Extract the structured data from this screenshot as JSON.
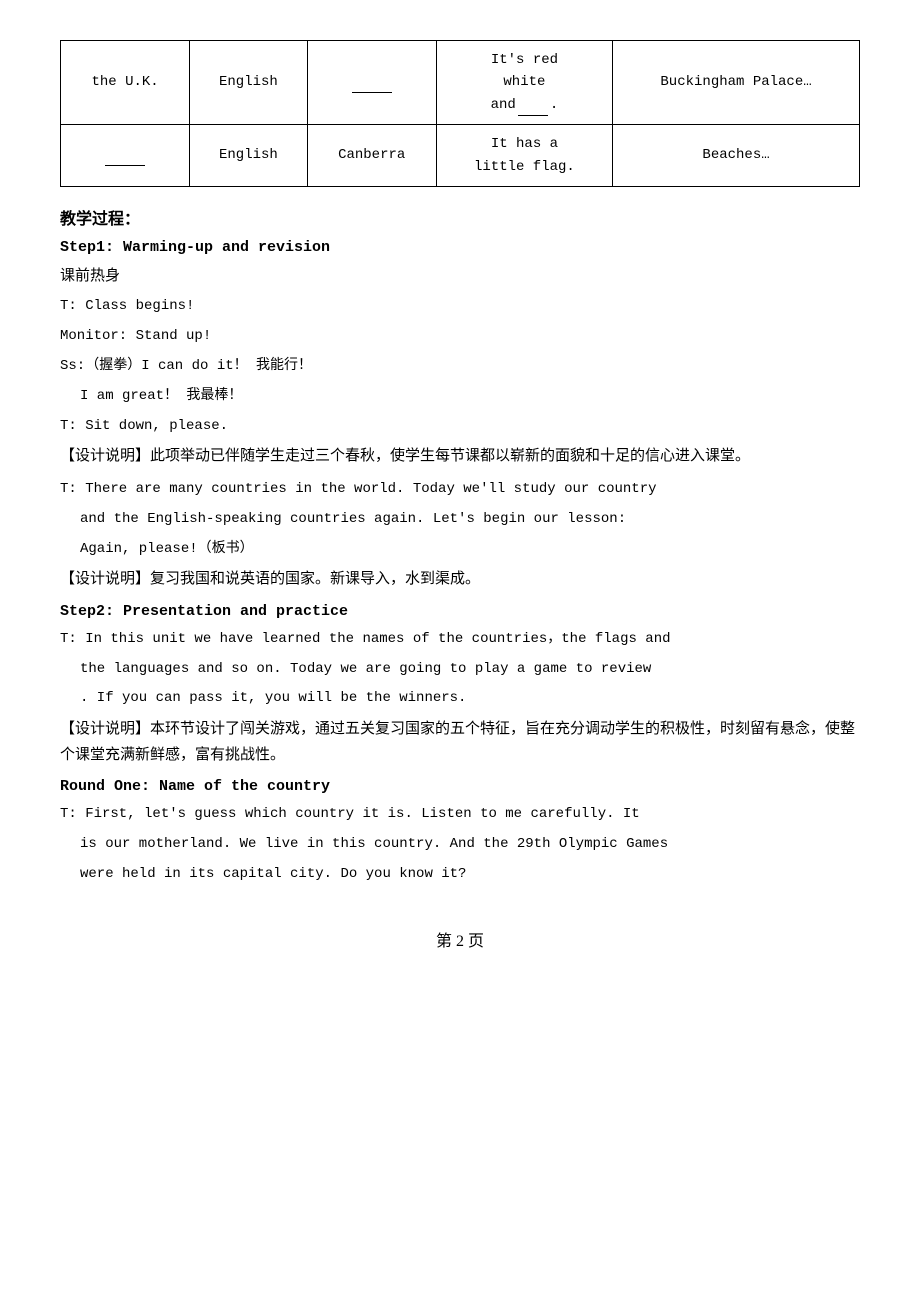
{
  "table": {
    "rows": [
      {
        "col1": "the U.K.",
        "col2": "English",
        "col3": "___",
        "col4": "It's red\nwhite\nand___.",
        "col5": "Buckingham Palace…"
      },
      {
        "col1": "___",
        "col2": "English",
        "col3": "Canberra",
        "col4": "It has a\nlittle flag.",
        "col5": "Beaches…"
      }
    ]
  },
  "teaching_process_heading": "教学过程：",
  "step1": {
    "heading": "Step1: Warming-up and revision",
    "lines": [
      {
        "type": "cn",
        "text": "课前热身"
      },
      {
        "type": "mono",
        "text": "T: Class begins!"
      },
      {
        "type": "mono",
        "text": "Monitor: Stand up!"
      },
      {
        "type": "mono",
        "text": "Ss:（握拳）I can do it！ 我能行！"
      },
      {
        "type": "mono-indent",
        "text": "I am great！ 我最棒！"
      },
      {
        "type": "mono",
        "text": "T: Sit down, please."
      }
    ],
    "design_note": "【设计说明】此项举动已伴随学生走过三个春秋，使学生每节课都以崭新的面貌和十足的信心进入课堂。",
    "dialogue": [
      {
        "type": "mono",
        "text": "T: There are many countries in the world. Today we'll study our country"
      },
      {
        "type": "mono-indent",
        "text": "and the English-speaking countries again. Let's begin our lesson:"
      },
      {
        "type": "mono-indent",
        "text": "Again, please!（板书）"
      }
    ],
    "design_note2": "【设计说明】复习我国和说英语的国家。新课导入，水到渠成。"
  },
  "step2": {
    "heading": "Step2: Presentation and practice",
    "lines": [
      {
        "type": "mono",
        "text": "T: In this unit we have learned the names of the countries，the flags and"
      },
      {
        "type": "mono-indent",
        "text": "the languages and so on. Today we are going to play a game to review"
      },
      {
        "type": "mono-indent",
        "text": ". If you can pass it, you will be the winners."
      }
    ],
    "design_note": "【设计说明】本环节设计了闯关游戏，通过五关复习国家的五个特征，旨在充分调动学生的积极性，时刻留有悬念，使整个课堂充满新鲜感，富有挑战性。",
    "round_heading": "Round One: Name of the country",
    "round_lines": [
      {
        "type": "mono",
        "text": "T: First, let's guess which country it is. Listen to me carefully. It"
      },
      {
        "type": "mono-indent",
        "text": "is our motherland. We live in this country. And the 29th Olympic Games"
      },
      {
        "type": "mono-indent",
        "text": "were held in its capital city. Do you know it?"
      }
    ]
  },
  "footer": {
    "text": "第 2 页"
  }
}
